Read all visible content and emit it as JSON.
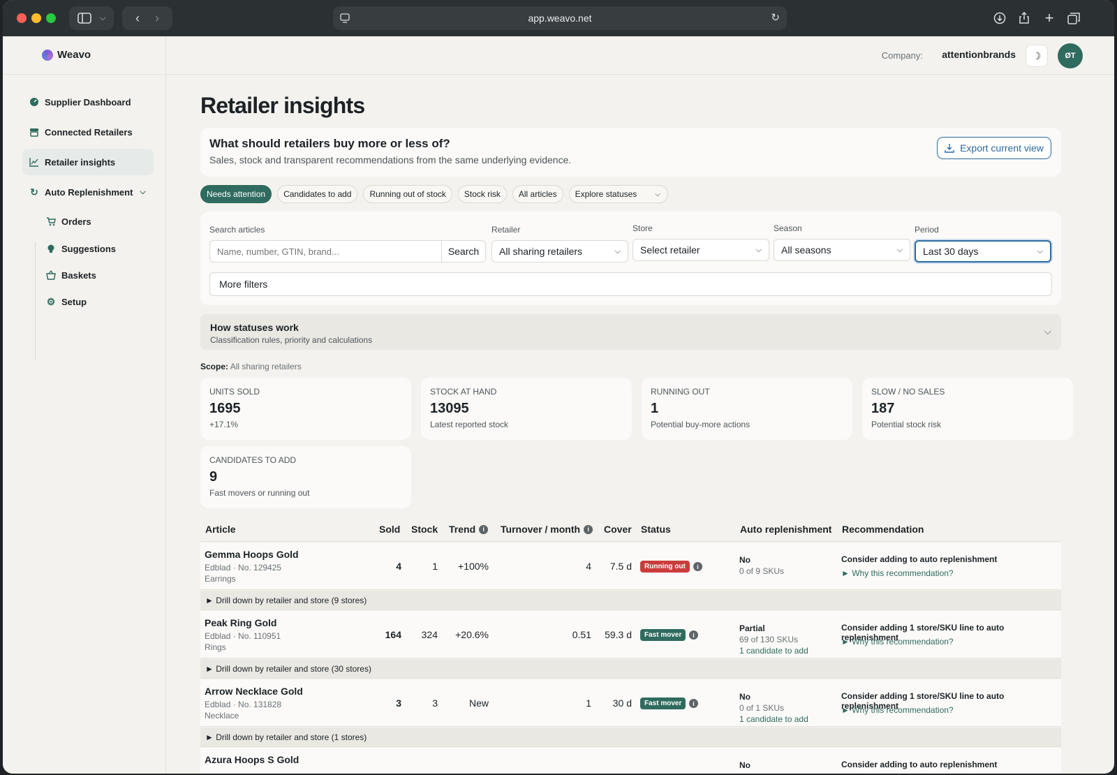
{
  "browser": {
    "url": "app.weavo.net"
  },
  "app": {
    "name": "Weavo"
  },
  "sidebar": {
    "items": [
      {
        "label": "Supplier Dashboard"
      },
      {
        "label": "Connected Retailers"
      },
      {
        "label": "Retailer insights"
      },
      {
        "label": "Auto Replenishment"
      }
    ],
    "sub_items": [
      {
        "label": "Orders"
      },
      {
        "label": "Suggestions"
      },
      {
        "label": "Baskets"
      },
      {
        "label": "Setup"
      }
    ]
  },
  "header": {
    "company_label": "Company:",
    "company_name": "attentionbrands",
    "avatar_initials": "ØT"
  },
  "page": {
    "title": "Retailer insights",
    "intro_question": "What should retailers buy more or less of?",
    "intro_subtitle": "Sales, stock and transparent recommendations from the same underlying evidence.",
    "export_label": "Export current view"
  },
  "chips": [
    {
      "label": "Needs attention"
    },
    {
      "label": "Candidates to add"
    },
    {
      "label": "Running out of stock"
    },
    {
      "label": "Stock risk"
    },
    {
      "label": "All articles"
    },
    {
      "label": "Explore statuses"
    }
  ],
  "filters": {
    "search_label": "Search articles",
    "search_placeholder": "Name, number, GTIN, brand...",
    "search_button": "Search",
    "retailer_label": "Retailer",
    "retailer_value": "All sharing retailers",
    "store_label": "Store",
    "store_value": "Select retailer",
    "season_label": "Season",
    "season_value": "All seasons",
    "period_label": "Period",
    "period_value": "Last 30 days",
    "more_filters": "More filters"
  },
  "status_help": {
    "title": "How statuses work",
    "subtitle": "Classification rules, priority and calculations"
  },
  "scope": {
    "label": "Scope:",
    "value": "All sharing retailers"
  },
  "kpis": [
    {
      "label": "UNITS SOLD",
      "value": "1695",
      "sub": "+17.1%"
    },
    {
      "label": "STOCK AT HAND",
      "value": "13095",
      "sub": "Latest reported stock"
    },
    {
      "label": "RUNNING OUT",
      "value": "1",
      "sub": "Potential buy-more actions"
    },
    {
      "label": "SLOW / NO SALES",
      "value": "187",
      "sub": "Potential stock risk"
    },
    {
      "label": "CANDIDATES TO ADD",
      "value": "9",
      "sub": "Fast movers or running out"
    }
  ],
  "table": {
    "headers": {
      "article": "Article",
      "sold": "Sold",
      "stock": "Stock",
      "trend": "Trend",
      "turnover": "Turnover / month",
      "cover": "Cover",
      "status": "Status",
      "auto": "Auto replenishment",
      "recommendation": "Recommendation"
    },
    "rows": [
      {
        "name": "Gemma Hoops Gold",
        "meta": "Edblad · No. 129425",
        "category": "Earrings",
        "sold": "4",
        "stock": "1",
        "trend": "+100%",
        "turnover": "4",
        "cover": "7.5 d",
        "status": "Running out",
        "status_color": "#cc3b3b",
        "auto1": "No",
        "auto2": "0 of 9 SKUs",
        "auto3": "",
        "rec": "Consider adding to auto replenishment",
        "why": "► Why this recommendation?",
        "drill": "► Drill down by retailer and store (9 stores)"
      },
      {
        "name": "Peak Ring Gold",
        "meta": "Edblad · No. 110951",
        "category": "Rings",
        "sold": "164",
        "stock": "324",
        "trend": "+20.6%",
        "turnover": "0.51",
        "cover": "59.3 d",
        "status": "Fast mover",
        "status_color": "#2f6b5e",
        "auto1": "Partial",
        "auto2": "69 of 130 SKUs",
        "auto3": "1 candidate to add",
        "rec": "Consider adding 1 store/SKU line to auto replenishment",
        "why": "► Why this recommendation?",
        "drill": "► Drill down by retailer and store (30 stores)"
      },
      {
        "name": "Arrow Necklace Gold",
        "meta": "Edblad · No. 131828",
        "category": "Necklace",
        "sold": "3",
        "stock": "3",
        "trend": "New",
        "turnover": "1",
        "cover": "30 d",
        "status": "Fast mover",
        "status_color": "#2f6b5e",
        "auto1": "No",
        "auto2": "0 of 1 SKUs",
        "auto3": "1 candidate to add",
        "rec": "Consider adding 1 store/SKU line to auto replenishment",
        "why": "► Why this recommendation?",
        "drill": "► Drill down by retailer and store (1 stores)"
      },
      {
        "name": "Azura Hoops S Gold",
        "meta": "",
        "category": "",
        "sold": "",
        "stock": "",
        "trend": "",
        "turnover": "",
        "cover": "",
        "status": "",
        "status_color": "#2f6b5e",
        "auto1": "No",
        "auto2": "",
        "auto3": "",
        "rec": "Consider adding to auto replenishment",
        "why": "",
        "drill": ""
      }
    ]
  }
}
